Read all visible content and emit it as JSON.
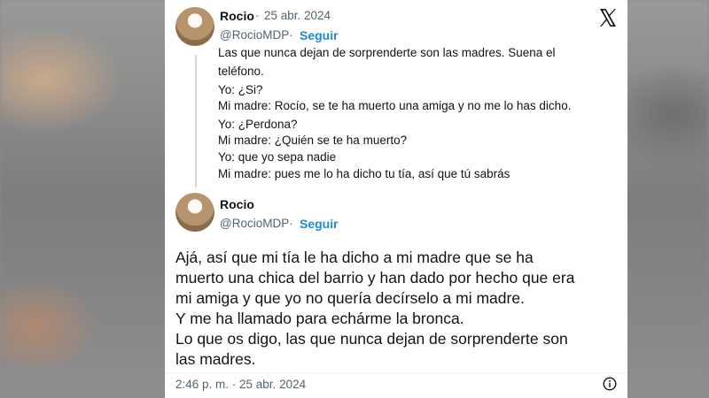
{
  "tweet1": {
    "name": "Rocio",
    "dot": "·",
    "date": "25 abr. 2024",
    "handle": "@RocioMDP",
    "follow_label": "Seguir",
    "lines": [
      "Las que nunca dejan de sorprenderte son las madres. Suena el",
      "teléfono.",
      "Yo: ¿Si?",
      "Mi madre: Rocío, se te ha muerto una amiga y no me lo has dicho.",
      "Yo: ¿Perdona?",
      "Mi madre: ¿Quién se te ha muerto?",
      "Yo: que yo sepa nadie",
      "Mi madre: pues me lo ha dicho tu tía, así que tú sabrás"
    ]
  },
  "tweet2": {
    "name": "Rocio",
    "handle": "@RocioMDP",
    "follow_label": "Seguir",
    "lines": [
      "Ajá, así que mi tía le ha dicho a mi madre que se ha",
      "muerto una chica del barrio y han dado por hecho que era",
      "mi amiga y que yo no quería decírselo a mi madre.",
      "Y me ha llamado para echárme la bronca.",
      "Lo que os digo, las que nunca dejan de sorprenderte son",
      "las madres."
    ],
    "timestamp": "2:46 p. m. · 25 abr. 2024"
  },
  "icons": {
    "brand": "x-logo-icon",
    "info": "info-icon"
  },
  "colors": {
    "link": "#1d8bd0",
    "text": "#0f1419",
    "muted": "#536471"
  }
}
